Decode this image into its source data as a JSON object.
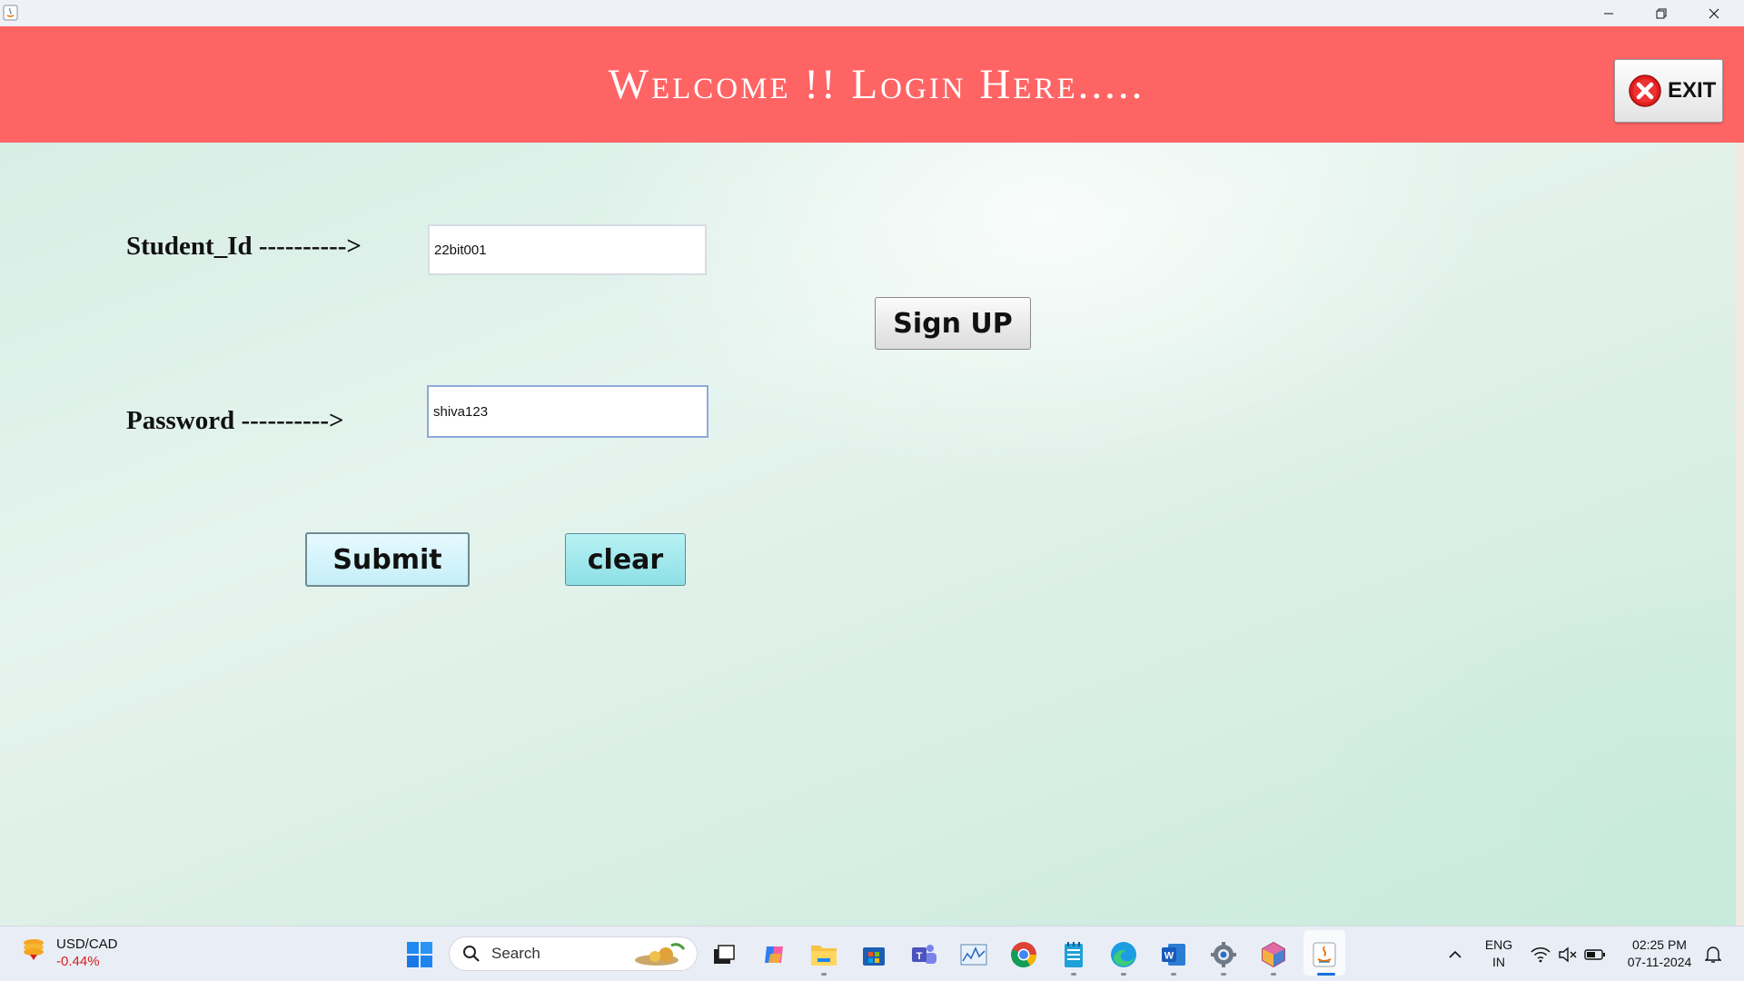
{
  "window": {
    "icon": "java-icon",
    "controls": {
      "minimize": "minimize-icon",
      "restore": "restore-icon",
      "close": "close-icon"
    }
  },
  "header": {
    "title": "Welcome !! Login Here.....",
    "exit_label": "EXIT",
    "background_color": "#ff6465"
  },
  "form": {
    "student_id_label": "Student_Id ---------->",
    "student_id_value": "22bit001",
    "password_label": "Password ---------->",
    "password_value": "shiva123",
    "signup_label": "Sign UP",
    "submit_label": "Submit",
    "clear_label": "clear"
  },
  "taskbar": {
    "widget": {
      "pair": "USD/CAD",
      "change": "-0.44%"
    },
    "search_label": "Search",
    "pinned": [
      "windows-start-icon",
      "search-icon",
      "task-view-icon",
      "copilot-icon",
      "file-explorer-icon",
      "microsoft-store-icon",
      "teams-icon",
      "resource-monitor-icon",
      "chrome-icon",
      "notepad-icon",
      "edge-icon",
      "word-icon",
      "settings-icon",
      "gem-app-icon",
      "java-icon"
    ],
    "tray": {
      "language": "ENG",
      "region": "IN",
      "time": "02:25 PM",
      "date": "07-11-2024"
    }
  }
}
